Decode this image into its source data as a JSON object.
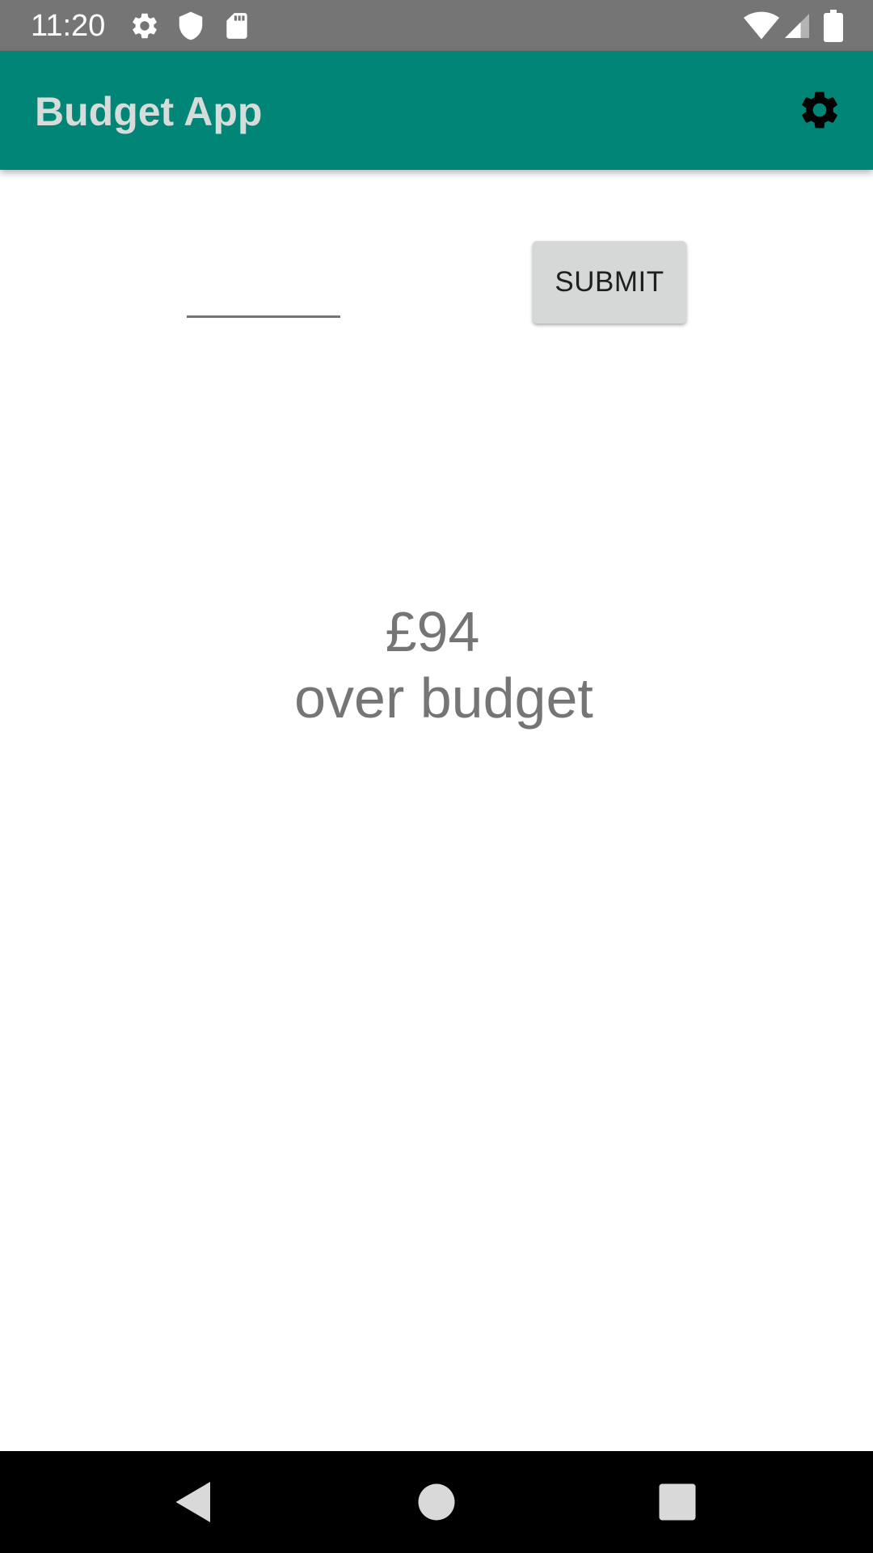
{
  "status_bar": {
    "time": "11:20",
    "left_icons": [
      "gear-icon",
      "shield-icon",
      "sd-card-icon"
    ],
    "right_icons": [
      "wifi-icon",
      "cell-signal-icon",
      "battery-icon"
    ]
  },
  "app_bar": {
    "title": "Budget App",
    "action_icon": "gear-icon",
    "background_color": "#008577"
  },
  "form": {
    "amount_value": "",
    "submit_label": "SUBMIT"
  },
  "budget": {
    "amount": "£94",
    "status": "over budget"
  },
  "nav_bar": {
    "buttons": [
      "back-icon",
      "home-icon",
      "recents-icon"
    ]
  }
}
